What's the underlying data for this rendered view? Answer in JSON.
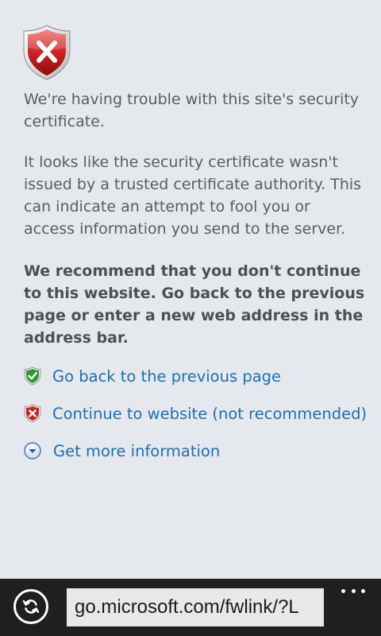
{
  "message": {
    "title": "We're having trouble with this site's security certificate.",
    "detail": "It looks like the security certificate wasn't issued by a trusted certificate authority. This can indicate an attempt to fool you or access information you send to the server.",
    "recommendation": "We recommend that you don't continue to this website. Go back to the previous page or enter a new web address in the address bar."
  },
  "links": {
    "go_back": "Go back to the previous page",
    "continue": "Continue to website (not recommended)",
    "more_info": "Get more information"
  },
  "appbar": {
    "address": "go.microsoft.com/fwlink/?L"
  },
  "colors": {
    "link": "#1d6fae",
    "background": "#e5e9ee",
    "appbar": "#1f1f1f"
  },
  "icons": [
    "error-shield-icon",
    "green-check-shield-icon",
    "red-x-shield-icon",
    "chevron-down-circle-icon",
    "refresh-icon",
    "more-dots-icon"
  ]
}
